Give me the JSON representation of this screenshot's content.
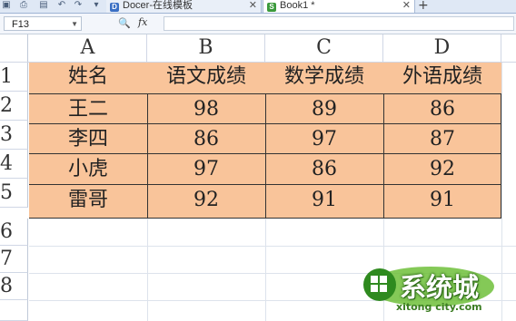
{
  "tabs": [
    {
      "label": "Docer-在线模板",
      "icon": "docer-icon"
    },
    {
      "label": "Book1 *",
      "icon": "sheet-icon"
    }
  ],
  "formula_bar": {
    "name_box": "F13",
    "fx": "fx",
    "formula": ""
  },
  "columns": [
    "A",
    "B",
    "C",
    "D"
  ],
  "rows": [
    "1",
    "2",
    "3",
    "4",
    "5",
    "6",
    "7",
    "8"
  ],
  "table": {
    "headers": [
      "姓名",
      "语文成绩",
      "数学成绩",
      "外语成绩"
    ],
    "data": [
      [
        "王二",
        "98",
        "89",
        "86"
      ],
      [
        "李四",
        "86",
        "97",
        "87"
      ],
      [
        "小虎",
        "97",
        "86",
        "92"
      ],
      [
        "雷哥",
        "92",
        "91",
        "91"
      ]
    ]
  },
  "colors": {
    "table_fill": "#f9c49a",
    "grid_line": "#dde3ec",
    "border": "#333333"
  },
  "watermark": {
    "text": "系统城",
    "url": "xitong city.com"
  }
}
